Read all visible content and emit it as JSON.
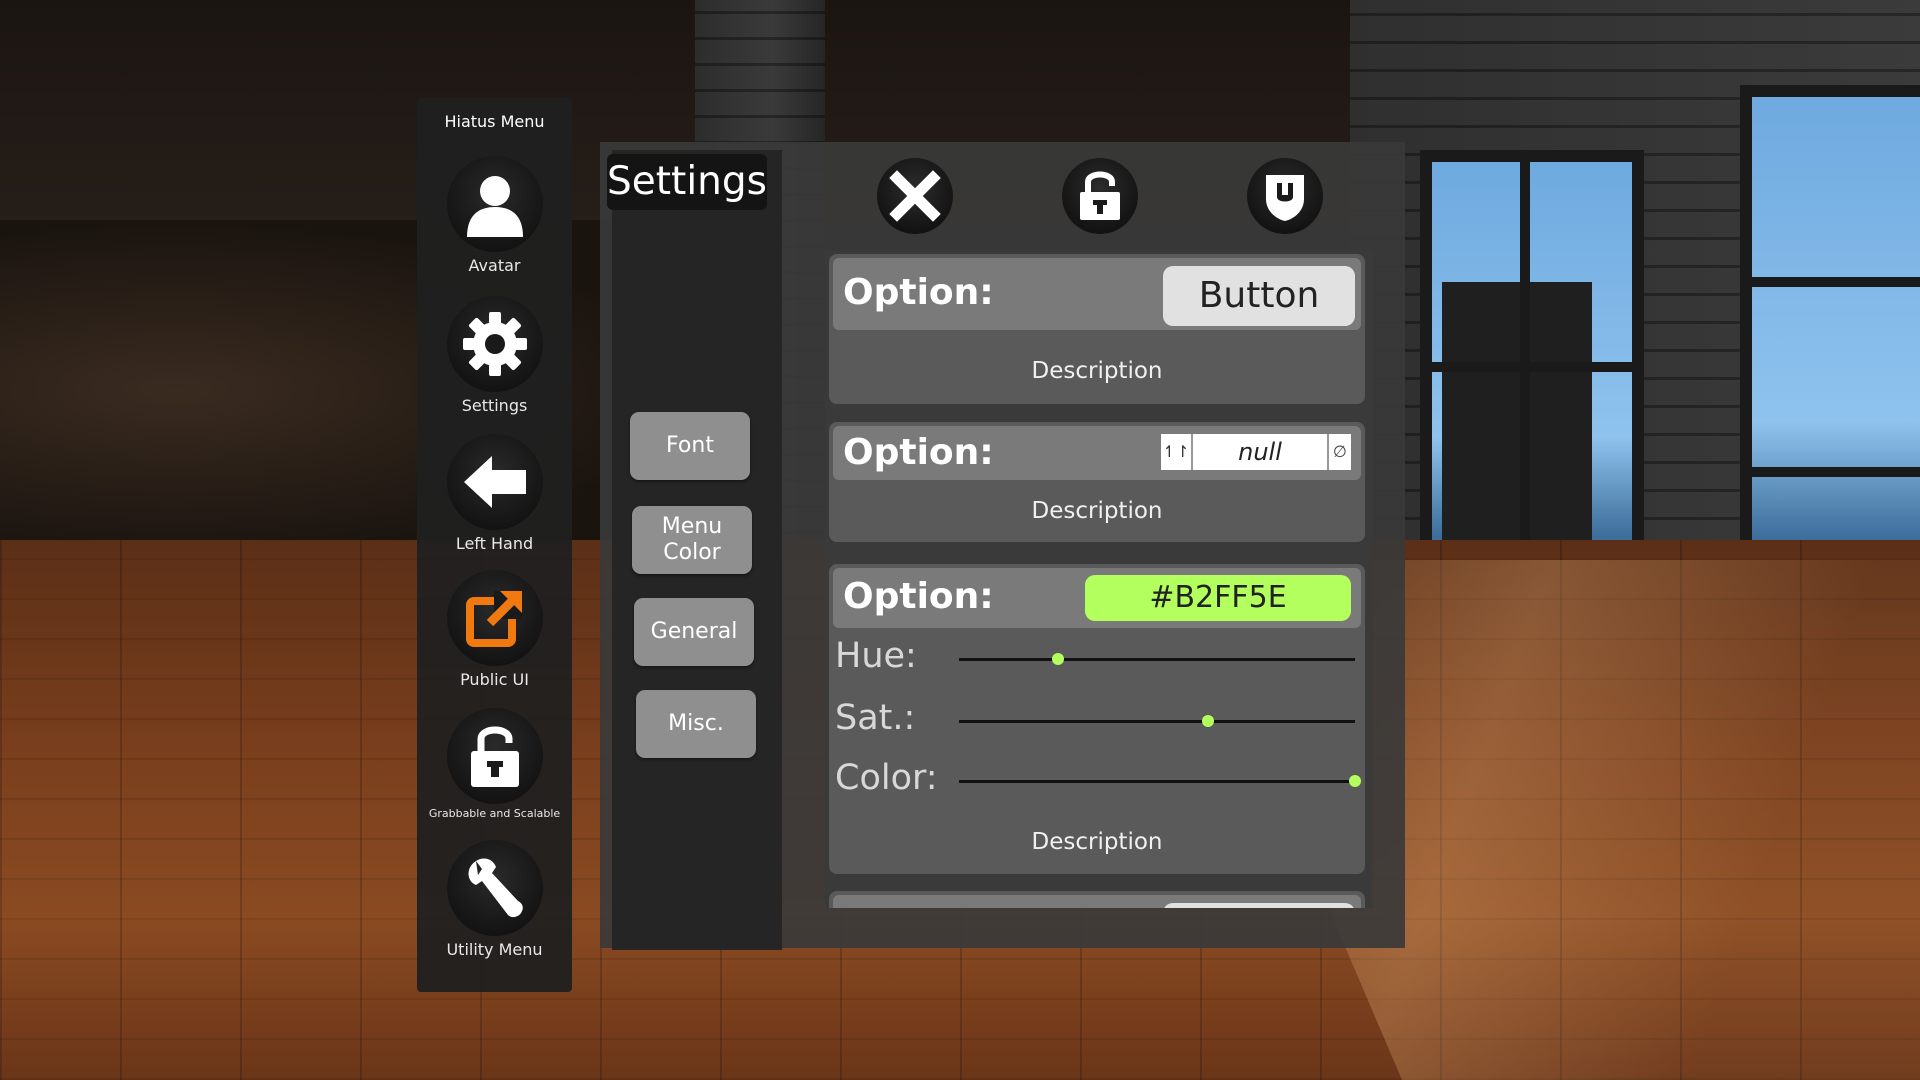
{
  "side_menu": {
    "title": "Hiatus Menu",
    "items": [
      {
        "label": "Avatar",
        "icon": "avatar-icon"
      },
      {
        "label": "Settings",
        "icon": "gear-icon"
      },
      {
        "label": "Left Hand",
        "icon": "arrow-left-icon"
      },
      {
        "label": "Public UI",
        "icon": "public-ui-icon"
      },
      {
        "label": "Grabbable and Scalable",
        "icon": "unlock-icon"
      },
      {
        "label": "Utility Menu",
        "icon": "wrench-icon"
      }
    ]
  },
  "settings": {
    "title": "Settings",
    "tabs": [
      {
        "label": "Font"
      },
      {
        "label": "Menu Color"
      },
      {
        "label": "General"
      },
      {
        "label": "Misc."
      }
    ],
    "top_icons": [
      "close-icon",
      "unlock-icon",
      "shield-icon"
    ],
    "options": [
      {
        "label": "Option:",
        "button_label": "Button",
        "description": "Description"
      },
      {
        "label": "Option:",
        "value": "null",
        "description": "Description"
      },
      {
        "label": "Option:",
        "color_hex": "#B2FF5E",
        "sliders": [
          {
            "label": "Hue:",
            "value": 0.25
          },
          {
            "label": "Sat.:",
            "value": 0.63
          },
          {
            "label": "Color:",
            "value": 1.0
          }
        ],
        "description": "Description"
      }
    ]
  },
  "colors": {
    "accent": "#B2FF5E",
    "orange_icon": "#f07a10"
  }
}
